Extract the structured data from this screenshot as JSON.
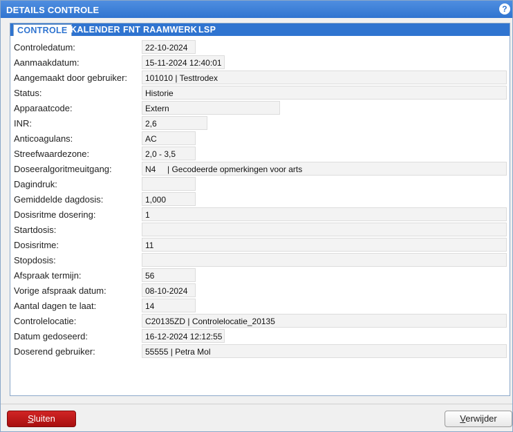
{
  "window": {
    "title": "DETAILS CONTROLE",
    "help_glyph": "?"
  },
  "tabs": [
    {
      "label": "CONTROLE",
      "active": true
    },
    {
      "label": "KALENDER",
      "active": false
    },
    {
      "label": "FNT RAAMWERK",
      "active": false
    },
    {
      "label": "LSP",
      "active": false
    }
  ],
  "fields": [
    {
      "label": "Controledatum:",
      "value": "22-10-2024"
    },
    {
      "label": "Aanmaakdatum:",
      "value": "15-11-2024 12:40:01"
    },
    {
      "label": "Aangemaakt door gebruiker:",
      "value": "101010 | Testtrodex"
    },
    {
      "label": "Status:",
      "value": "Historie"
    },
    {
      "label": "Apparaatcode:",
      "value": "Extern"
    },
    {
      "label": "INR:",
      "value": "2,6"
    },
    {
      "label": "Anticoagulans:",
      "value": "AC"
    },
    {
      "label": "Streefwaardezone:",
      "value": "2,0 - 3,5"
    },
    {
      "label": "Doseeralgoritmeuitgang:",
      "value": "N4     | Gecodeerde opmerkingen voor arts"
    },
    {
      "label": "Dagindruk:",
      "value": ""
    },
    {
      "label": "Gemiddelde dagdosis:",
      "value": "1,000"
    },
    {
      "label": "Dosisritme dosering:",
      "value": "1"
    },
    {
      "label": "Startdosis:",
      "value": ""
    },
    {
      "label": "Dosisritme:",
      "value": "11"
    },
    {
      "label": "Stopdosis:",
      "value": ""
    },
    {
      "label": "Afspraak termijn:",
      "value": "56"
    },
    {
      "label": "Vorige afspraak datum:",
      "value": "08-10-2024"
    },
    {
      "label": "Aantal dagen te laat:",
      "value": "14"
    },
    {
      "label": "Controlelocatie:",
      "value": "C20135ZD | Controlelocatie_20135"
    },
    {
      "label": "Datum gedoseerd:",
      "value": "16-12-2024 12:12:55"
    },
    {
      "label": "Doserend gebruiker:",
      "value": "55555 | Petra Mol"
    }
  ],
  "buttons": {
    "close_label": "Sluiten",
    "delete_label": "Verwijder"
  },
  "colors": {
    "title_bar": "#2f74d0",
    "close_button": "#c01818"
  }
}
